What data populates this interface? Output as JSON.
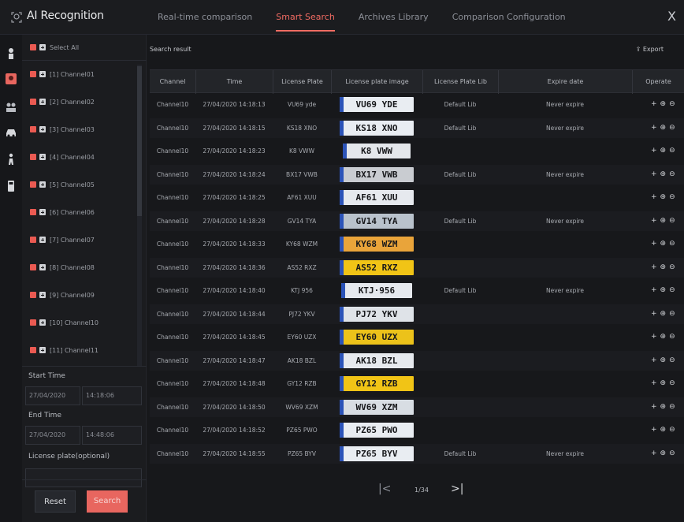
{
  "app": {
    "title": "AI Recognition",
    "close": "X"
  },
  "tabs": [
    {
      "label": "Real-time comparison",
      "active": false
    },
    {
      "label": "Smart Search",
      "active": true
    },
    {
      "label": "Archives Library",
      "active": false
    },
    {
      "label": "Comparison Configuration",
      "active": false
    }
  ],
  "rail_icons": [
    "person-icon",
    "face-recognition-icon",
    "person-group-icon",
    "vehicle-icon",
    "person-walk-icon",
    "device-icon"
  ],
  "channels": {
    "select_all": "Select All",
    "items": [
      "[1] Channel01",
      "[2] Channel02",
      "[3] Channel03",
      "[4] Channel04",
      "[5] Channel05",
      "[6] Channel06",
      "[7] Channel07",
      "[8] Channel08",
      "[9] Channel09",
      "[10] Channel10",
      "[11] Channel11"
    ]
  },
  "filters": {
    "start_label": "Start Time",
    "start_date": "27/04/2020",
    "start_time": "14:18:06",
    "end_label": "End Time",
    "end_date": "27/04/2020",
    "end_time": "14:48:06",
    "plate_label": "License plate(optional)",
    "plate_value": ""
  },
  "buttons": {
    "reset": "Reset",
    "search": "Search"
  },
  "result": {
    "title": "Search result",
    "export": "Export"
  },
  "columns": [
    "Channel",
    "Time",
    "License Plate",
    "License plate image",
    "License Plate Lib",
    "Expire date",
    "Operate"
  ],
  "rows": [
    {
      "channel": "Channel10",
      "time": "27/04/2020 14:18:13",
      "plate": "VU69 yde",
      "image_text": "VU69 YDE",
      "plate_color": "#e9edf2",
      "lib": "Default Lib",
      "expire": "Never expire"
    },
    {
      "channel": "Channel10",
      "time": "27/04/2020 14:18:15",
      "plate": "KS18 XNO",
      "image_text": "KS18 XNO",
      "plate_color": "#e9edf2",
      "lib": "Default Lib",
      "expire": "Never expire"
    },
    {
      "channel": "Channel10",
      "time": "27/04/2020 14:18:23",
      "plate": "K8 VWW",
      "image_text": "K8 VWW",
      "plate_color": "#e4e7eb",
      "lib": "",
      "expire": ""
    },
    {
      "channel": "Channel10",
      "time": "27/04/2020 14:18:24",
      "plate": "BX17 VWB",
      "image_text": "BX17 VWB",
      "plate_color": "#c9ccd1",
      "lib": "Default Lib",
      "expire": "Never expire"
    },
    {
      "channel": "Channel10",
      "time": "27/04/2020 14:18:25",
      "plate": "AF61 XUU",
      "image_text": "AF61 XUU",
      "plate_color": "#e6e9ee",
      "lib": "",
      "expire": ""
    },
    {
      "channel": "Channel10",
      "time": "27/04/2020 14:18:28",
      "plate": "GV14 TYA",
      "image_text": "GV14 TYA",
      "plate_color": "#b9c2cc",
      "lib": "Default Lib",
      "expire": "Never expire"
    },
    {
      "channel": "Channel10",
      "time": "27/04/2020 14:18:33",
      "plate": "KY68 WZM",
      "image_text": "KY68 WZM",
      "plate_color": "#e9a43a",
      "lib": "",
      "expire": ""
    },
    {
      "channel": "Channel10",
      "time": "27/04/2020 14:18:36",
      "plate": "AS52 RXZ",
      "image_text": "AS52 RXZ",
      "plate_color": "#f1c416",
      "lib": "",
      "expire": ""
    },
    {
      "channel": "Channel10",
      "time": "27/04/2020 14:18:40",
      "plate": "KTJ 956",
      "image_text": "KTJ·956",
      "plate_color": "#e6e9ee",
      "lib": "Default Lib",
      "expire": "Never expire"
    },
    {
      "channel": "Channel10",
      "time": "27/04/2020 14:18:44",
      "plate": "PJ72 YKV",
      "image_text": "PJ72 YKV",
      "plate_color": "#dfe3e8",
      "lib": "",
      "expire": ""
    },
    {
      "channel": "Channel10",
      "time": "27/04/2020 14:18:45",
      "plate": "EY60 UZX",
      "image_text": "EY60 UZX",
      "plate_color": "#ecc21a",
      "lib": "",
      "expire": ""
    },
    {
      "channel": "Channel10",
      "time": "27/04/2020 14:18:47",
      "plate": "AK18 BZL",
      "image_text": "AK18 BZL",
      "plate_color": "#e6e9ee",
      "lib": "",
      "expire": ""
    },
    {
      "channel": "Channel10",
      "time": "27/04/2020 14:18:48",
      "plate": "GY12 RZB",
      "image_text": "GY12 RZB",
      "plate_color": "#f1c416",
      "lib": "",
      "expire": ""
    },
    {
      "channel": "Channel10",
      "time": "27/04/2020 14:18:50",
      "plate": "WV69 XZM",
      "image_text": "WV69 XZM",
      "plate_color": "#d8dde3",
      "lib": "",
      "expire": ""
    },
    {
      "channel": "Channel10",
      "time": "27/04/2020 14:18:52",
      "plate": "PZ65 PWO",
      "image_text": "PZ65 PWO",
      "plate_color": "#e9edf2",
      "lib": "",
      "expire": ""
    },
    {
      "channel": "Channel10",
      "time": "27/04/2020 14:18:55",
      "plate": "PZ65 BYV",
      "image_text": "PZ65 BYV",
      "plate_color": "#e9edf2",
      "lib": "Default Lib",
      "expire": "Never expire"
    }
  ],
  "operate": {
    "add": "+",
    "edit": "⊕",
    "view": "⊖"
  },
  "pager": {
    "first": "|<",
    "text": "1/34",
    "last": ">|"
  },
  "colors": {
    "accent": "#f06b62",
    "background": "#141517",
    "panel": "#1b1c1f"
  }
}
